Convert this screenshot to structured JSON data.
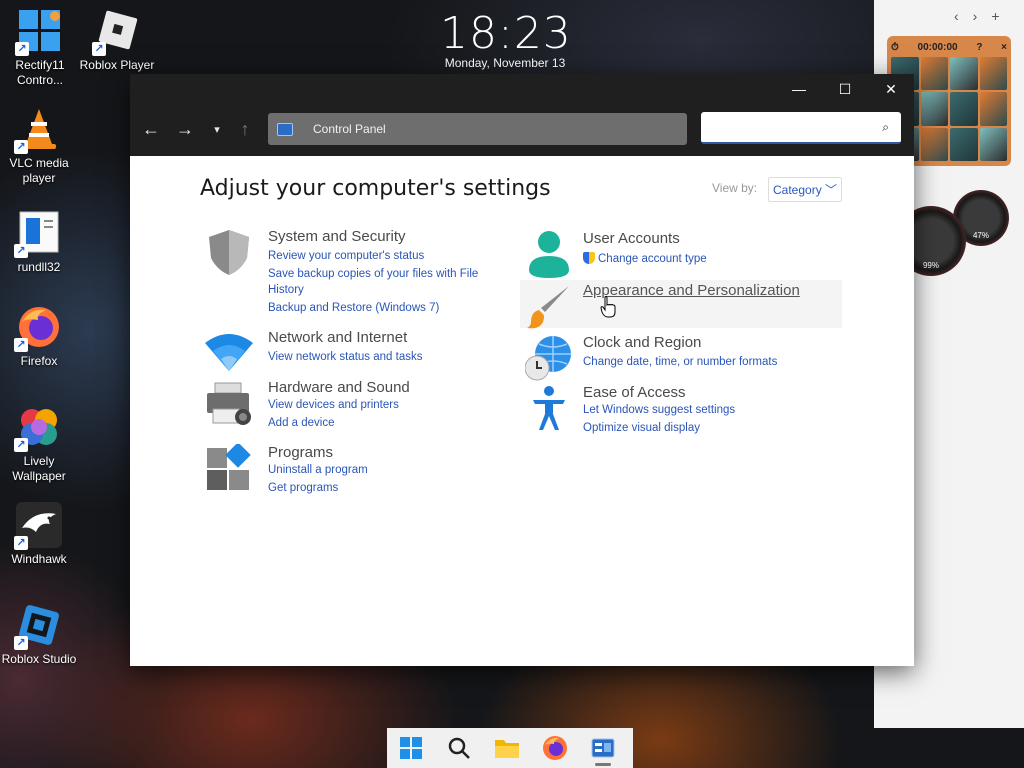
{
  "desktop": {
    "icons": [
      {
        "label": "Rectify11 Contro...",
        "icon": "control-panel-icon"
      },
      {
        "label": "Roblox Player",
        "icon": "roblox-icon"
      },
      {
        "label": "VLC media player",
        "icon": "vlc-icon"
      },
      {
        "label": "rundll32",
        "icon": "document-icon"
      },
      {
        "label": "Firefox",
        "icon": "firefox-icon"
      },
      {
        "label": "Lively Wallpaper",
        "icon": "lively-icon"
      },
      {
        "label": "Windhawk",
        "icon": "eagle-icon"
      },
      {
        "label": "Roblox Studio",
        "icon": "roblox-studio-icon"
      }
    ],
    "clock": {
      "time": "18:23",
      "date": "Monday, November 13"
    }
  },
  "side_panel": {
    "widget_time": "00:00:00",
    "gauge_left": "99%",
    "gauge_right": "47%"
  },
  "window": {
    "address": "Control Panel",
    "search_placeholder": "",
    "heading": "Adjust your computer's settings",
    "view_by_label": "View by:",
    "view_by_value": "Category",
    "categories_left": [
      {
        "title": "System and Security",
        "links": [
          "Review your computer's status",
          "Save backup copies of your files with File",
          "History",
          "Backup and Restore (Windows 7)"
        ]
      },
      {
        "title": "Network and Internet",
        "links": [
          "View network status and tasks"
        ]
      },
      {
        "title": "Hardware and Sound",
        "links": [
          "View devices and printers",
          "Add a device"
        ]
      },
      {
        "title": "Programs",
        "links": [
          "Uninstall a program",
          "Get programs"
        ]
      }
    ],
    "categories_right": [
      {
        "title": "User Accounts",
        "links": [
          "Change account type"
        ]
      },
      {
        "title": "Appearance and Personalization",
        "links": []
      },
      {
        "title": "Clock and Region",
        "links": [
          "Change date, time, or number formats"
        ]
      },
      {
        "title": "Ease of Access",
        "links": [
          "Let Windows suggest settings",
          "Optimize visual display"
        ]
      }
    ]
  },
  "colors": {
    "link": "#2a55b8",
    "accent": "#2b6cc4",
    "titlebar": "#1f1f1f"
  }
}
